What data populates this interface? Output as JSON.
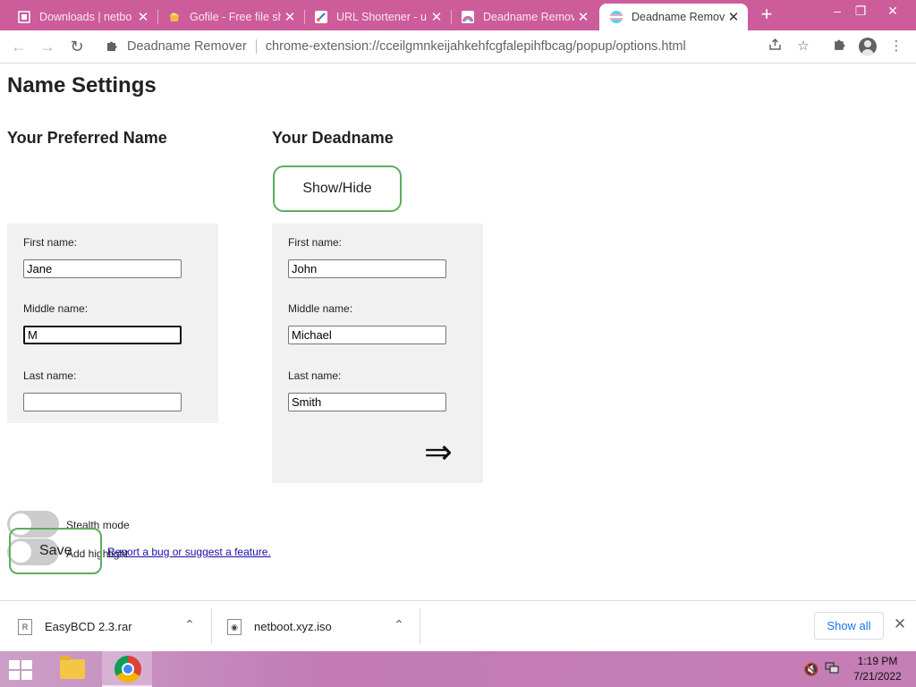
{
  "browser": {
    "tabs": [
      {
        "title": "Downloads | netbo",
        "icon": "downloads-favicon",
        "active": false
      },
      {
        "title": "Gofile - Free file sh",
        "icon": "gofile-favicon",
        "active": false
      },
      {
        "title": "URL Shortener - u",
        "icon": "url-shortener-favicon",
        "active": false
      },
      {
        "title": "Deadname Remov",
        "icon": "deadname-remover-favicon",
        "active": false
      },
      {
        "title": "Deadname Remov",
        "icon": "trans-flag-favicon",
        "active": true
      }
    ],
    "new_tab_glyph": "+",
    "address": {
      "site_name": "Deadname Remover",
      "url": "chrome-extension://cceilgmnkeijahkehfcgfalepihfbcag/popup/options.html"
    }
  },
  "page": {
    "title": "Name Settings",
    "preferred": {
      "heading": "Your Preferred Name",
      "fields": [
        {
          "label": "First name:",
          "value": "Jane"
        },
        {
          "label": "Middle name:",
          "value": "M"
        },
        {
          "label": "Last name:",
          "value": ""
        }
      ]
    },
    "deadname": {
      "heading": "Your Deadname",
      "show_hide_label": "Show/Hide",
      "fields": [
        {
          "label": "First name:",
          "value": "John"
        },
        {
          "label": "Middle name:",
          "value": "Michael"
        },
        {
          "label": "Last name:",
          "value": "Smith"
        }
      ],
      "arrow_glyph": "⇒"
    },
    "options": {
      "stealth_mode_label": "Stealth mode",
      "stealth_mode_on": false,
      "add_highlight_label": "Add highlight",
      "add_highlight_on": false
    },
    "save_label": "Save",
    "report_link": "Report a bug or suggest a feature."
  },
  "downloads": {
    "items": [
      {
        "name": "EasyBCD 2.3.rar",
        "icon": "rar-archive-icon"
      },
      {
        "name": "netboot.xyz.iso",
        "icon": "iso-file-icon"
      }
    ],
    "show_all_label": "Show all"
  },
  "taskbar": {
    "time": "1:19 PM",
    "date": "7/21/2022"
  }
}
